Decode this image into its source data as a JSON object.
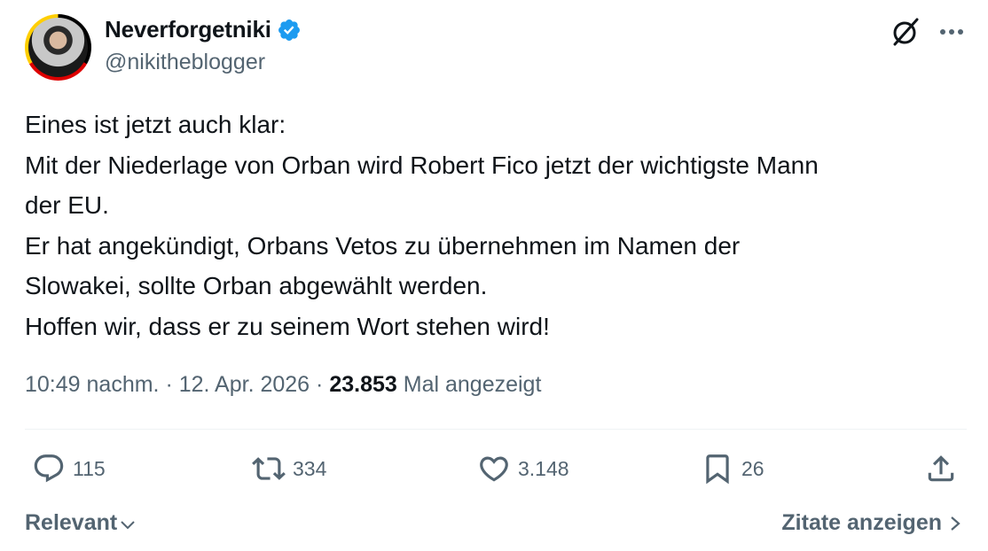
{
  "author": {
    "display_name": "Neverforgetniki",
    "handle": "@nikitheblogger",
    "verified": true
  },
  "icons": {
    "verified": "verified-badge-icon",
    "grok": "grok-icon",
    "more": "more-options-icon",
    "reply": "reply-icon",
    "retweet": "retweet-icon",
    "like": "heart-icon",
    "bookmark": "bookmark-icon",
    "share": "share-icon"
  },
  "colors": {
    "text": "#0f1419",
    "muted": "#536471",
    "verified": "#1d9bf0"
  },
  "tweet": {
    "lines": [
      "Eines ist jetzt auch klar:",
      "Mit der Niederlage von Orban wird Robert Fico jetzt der wichtigste Mann",
      "der EU.",
      "Er hat angekündigt, Orbans Vetos zu übernehmen im Namen der",
      "Slowakei, sollte Orban abgewählt werden.",
      "Hoffen wir, dass er zu seinem Wort stehen wird!"
    ]
  },
  "meta": {
    "time": "10:49 nachm.",
    "separator": "·",
    "date": "12. Apr. 2026",
    "views_count": "23.853",
    "views_label": "Mal angezeigt"
  },
  "actions": {
    "replies": "115",
    "retweets": "334",
    "likes": "3.148",
    "bookmarks": "26"
  },
  "footer": {
    "sort_label": "Relevant",
    "quotes_label": "Zitate anzeigen"
  }
}
